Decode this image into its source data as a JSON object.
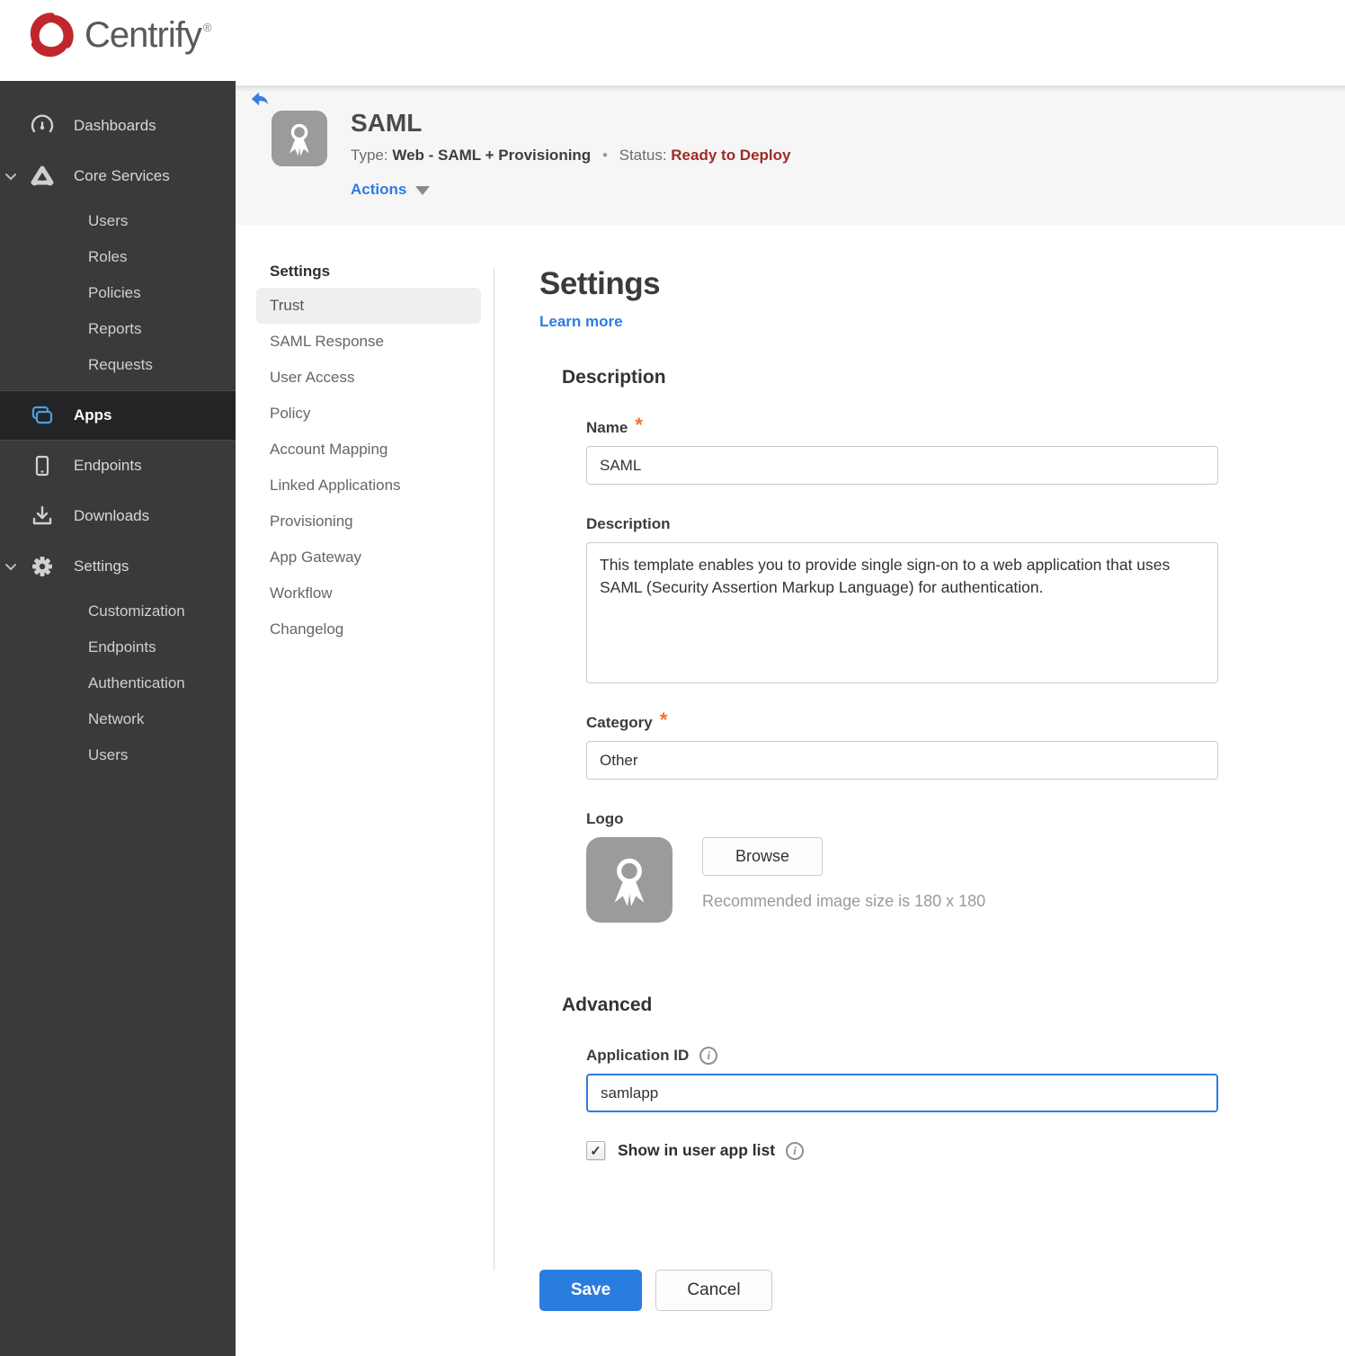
{
  "brand": {
    "name": "Centrify",
    "registered": "®"
  },
  "sidebar": {
    "dashboards": "Dashboards",
    "core_services": "Core Services",
    "core_children": [
      "Users",
      "Roles",
      "Policies",
      "Reports",
      "Requests"
    ],
    "apps": "Apps",
    "endpoints": "Endpoints",
    "downloads": "Downloads",
    "settings": "Settings",
    "settings_children": [
      "Customization",
      "Endpoints",
      "Authentication",
      "Network",
      "Users"
    ]
  },
  "header": {
    "title": "SAML",
    "type_label": "Type:",
    "type_value": "Web - SAML + Provisioning",
    "separator": "•",
    "status_label": "Status:",
    "status_value": "Ready to Deploy",
    "actions_label": "Actions"
  },
  "subnav": {
    "heading": "Settings",
    "active_item": "Trust",
    "items": [
      "Trust",
      "SAML Response",
      "User Access",
      "Policy",
      "Account Mapping",
      "Linked Applications",
      "Provisioning",
      "App Gateway",
      "Workflow",
      "Changelog"
    ]
  },
  "main": {
    "heading": "Settings",
    "learn_more": "Learn more",
    "description_section": "Description",
    "name_label": "Name",
    "name_value": "SAML",
    "required_marker": "*",
    "description_label": "Description",
    "description_value": "This template enables you to provide single sign-on to a web application that uses SAML (Security Assertion Markup Language) for authentication.",
    "category_label": "Category",
    "category_value": "Other",
    "logo_label": "Logo",
    "browse_button": "Browse",
    "logo_hint": "Recommended image size is 180 x 180",
    "advanced_section": "Advanced",
    "app_id_label": "Application ID",
    "app_id_value": "samlapp",
    "checkbox_checked": "✓",
    "show_in_list_label": "Show in user app list",
    "info_glyph": "i",
    "save_button": "Save",
    "cancel_button": "Cancel"
  },
  "colors": {
    "accent_blue": "#2b7cdf",
    "link_blue": "#2e7ce0",
    "status_red": "#9e2b24",
    "required_orange": "#ee7624",
    "sidebar_bg": "#3a3a3c",
    "sidebar_active_bg": "#242426",
    "apps_icon_blue": "#4aa0e0",
    "header_bg": "#f6f6f6",
    "logo_red": "#bf272d"
  }
}
